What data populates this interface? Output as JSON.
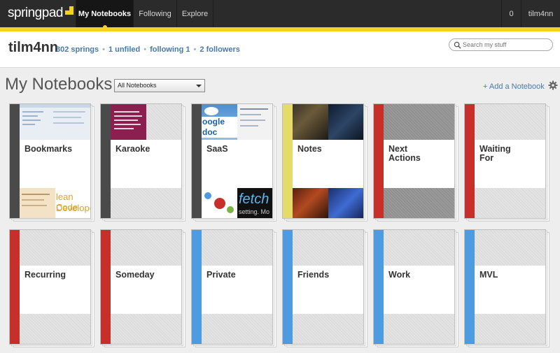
{
  "nav": {
    "logo": "springpad",
    "tabs": [
      {
        "label": "My Notebooks",
        "active": true
      },
      {
        "label": "Following",
        "active": false
      },
      {
        "label": "Explore",
        "active": false
      }
    ],
    "notification_count": "0",
    "username": "tilm4nn",
    "accent_color": "#f4d21f"
  },
  "profile": {
    "username": "tilm4nn",
    "stats": [
      "302 springs",
      "1 unfiled",
      "following 1",
      "2 followers"
    ],
    "search_placeholder": "Search my stuff"
  },
  "section": {
    "title": "My Notebooks",
    "filter_selected": "All Notebooks",
    "add_label": "+ Add a Notebook"
  },
  "thumb_text": {
    "saas_1": "oogle doc",
    "saas_2": "fetch",
    "saas_3": "setting. Mo",
    "bookmarks_1": "lean Code",
    "bookmarks_2": "Developer"
  },
  "notebooks": [
    {
      "label": "Bookmarks",
      "spine_color": "#4a4a4a"
    },
    {
      "label": "Karaoke",
      "spine_color": "#4a4a4a"
    },
    {
      "label": "SaaS",
      "spine_color": "#4a4a4a"
    },
    {
      "label": "Notes",
      "spine_color": "#e6db6a"
    },
    {
      "label": "Next Actions",
      "spine_color": "#c62f2a"
    },
    {
      "label": "Waiting For",
      "spine_color": "#c62f2a"
    },
    {
      "label": "Recurring",
      "spine_color": "#c62f2a"
    },
    {
      "label": "Someday",
      "spine_color": "#c62f2a"
    },
    {
      "label": "Private",
      "spine_color": "#4f9be0"
    },
    {
      "label": "Friends",
      "spine_color": "#4f9be0"
    },
    {
      "label": "Work",
      "spine_color": "#4f9be0"
    },
    {
      "label": "MVL",
      "spine_color": "#4f9be0"
    }
  ]
}
